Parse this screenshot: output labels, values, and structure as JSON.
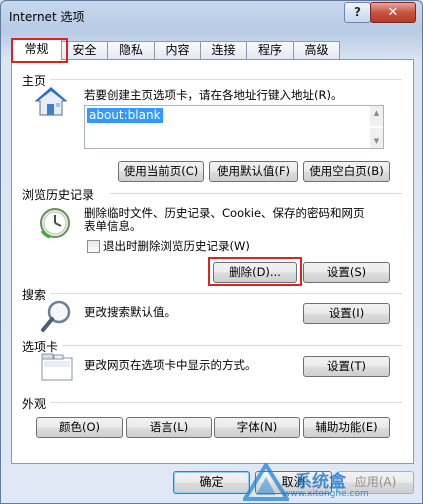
{
  "window": {
    "title": "Internet 选项",
    "help_label": "?",
    "close_label": "✕"
  },
  "tabs": [
    {
      "label": "常规"
    },
    {
      "label": "安全"
    },
    {
      "label": "隐私"
    },
    {
      "label": "内容"
    },
    {
      "label": "连接"
    },
    {
      "label": "程序"
    },
    {
      "label": "高级"
    }
  ],
  "homepage": {
    "heading": "主页",
    "description": "若要创建主页选项卡，请在各地址行键入地址(R)。",
    "value": "about:blank",
    "buttons": {
      "use_current": "使用当前页(C)",
      "use_default": "使用默认值(F)",
      "use_blank": "使用空白页(B)"
    }
  },
  "history": {
    "heading": "浏览历史记录",
    "description_line1": "删除临时文件、历史记录、Cookie、保存的密码和网页",
    "description_line2": "表单信息。",
    "checkbox_label": "退出时删除浏览历史记录(W)",
    "checkbox_checked": false,
    "buttons": {
      "delete": "删除(D)...",
      "settings": "设置(S)"
    }
  },
  "search": {
    "heading": "搜索",
    "description": "更改搜索默认值。",
    "settings_label": "设置(I)"
  },
  "tabs_section": {
    "heading": "选项卡",
    "description": "更改网页在选项卡中显示的方式。",
    "settings_label": "设置(T)"
  },
  "appearance": {
    "heading": "外观",
    "buttons": {
      "colors": "颜色(O)",
      "languages": "语言(L)",
      "fonts": "字体(N)",
      "accessibility": "辅助功能(E)"
    }
  },
  "footer": {
    "ok": "确定",
    "cancel": "取消",
    "apply": "应用(A)"
  },
  "watermark": {
    "text": "系统盒",
    "url": "www.xitonghe.com"
  },
  "colors": {
    "highlight_red": "#d9261c",
    "selection_blue": "#3399ff"
  }
}
